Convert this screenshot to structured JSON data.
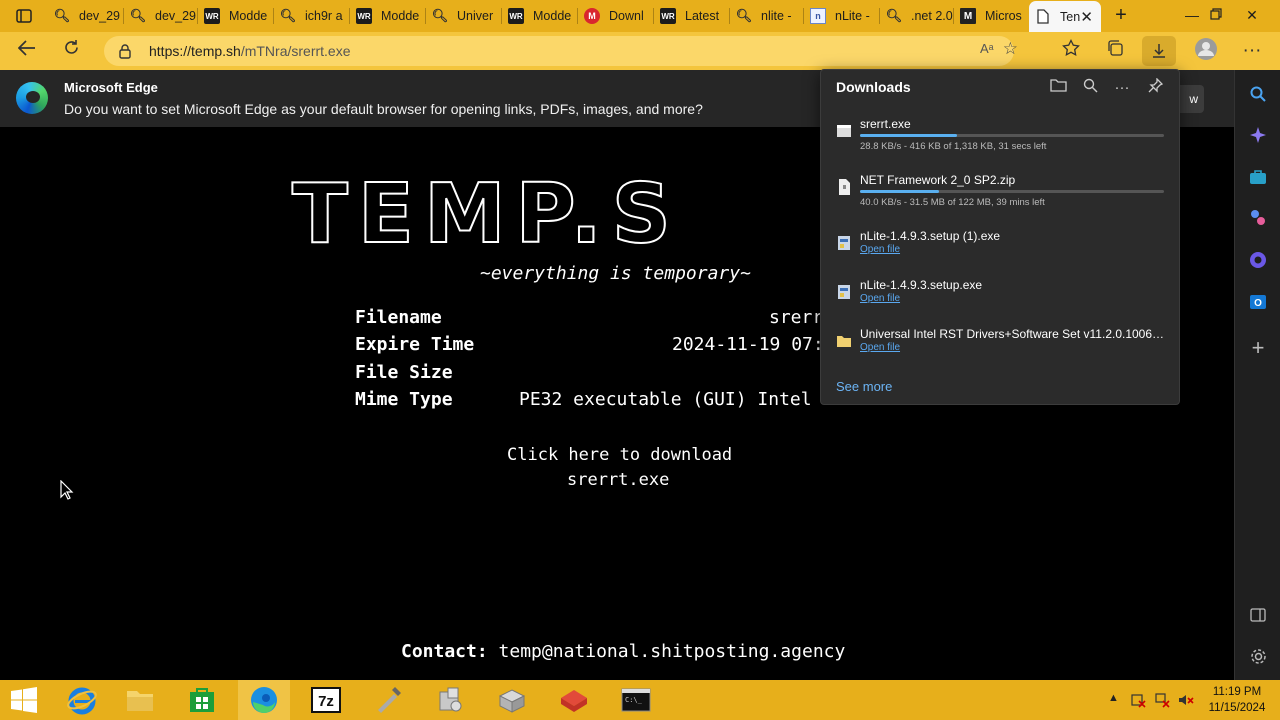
{
  "tabs": [
    {
      "label": "dev_29",
      "icon": "search-icon"
    },
    {
      "label": "dev_29",
      "icon": "search-icon"
    },
    {
      "label": "Modde",
      "icon": "wr-icon"
    },
    {
      "label": "ich9r a",
      "icon": "search-icon"
    },
    {
      "label": "Modde",
      "icon": "wr-icon"
    },
    {
      "label": "Univer",
      "icon": "search-icon"
    },
    {
      "label": "Modde",
      "icon": "wr-icon"
    },
    {
      "label": "Downl",
      "icon": "mega-icon"
    },
    {
      "label": "Latest",
      "icon": "wr-icon"
    },
    {
      "label": "nlite -",
      "icon": "search-icon"
    },
    {
      "label": "nLite -",
      "icon": "page-icon"
    },
    {
      "label": ".net 2.0",
      "icon": "search-icon"
    },
    {
      "label": "Micros",
      "icon": "ms-icon"
    },
    {
      "label": "Ten",
      "icon": "document-icon",
      "active": true
    }
  ],
  "address_bar": {
    "url_host": "https://temp.sh",
    "url_path": "/mTNra/srerrt.exe"
  },
  "banner": {
    "title": "Microsoft Edge",
    "text": "Do you want to set Microsoft Edge as your default browser for opening links, PDFs, images, and more?",
    "button": "w"
  },
  "page": {
    "logo": "TEMP.S",
    "tagline": "~everything is temporary~",
    "info": [
      {
        "label": "Filename",
        "value": "srerr"
      },
      {
        "label": "Expire Time",
        "value": "2024-11-19 07:"
      },
      {
        "label": "File Size",
        "value": ""
      },
      {
        "label": "Mime Type",
        "value": "PE32 executable (GUI) Intel"
      }
    ],
    "download_link": "Click here to download",
    "download_name": "srerrt.exe",
    "contact_label": "Contact:",
    "contact_email": "temp@national.shitposting.agency"
  },
  "downloads": {
    "title": "Downloads",
    "items": [
      {
        "name": "srerrt.exe",
        "status": "28.8 KB/s - 416 KB of 1,318 KB, 31 secs left",
        "progress": 0.32
      },
      {
        "name": "NET Framework 2_0 SP2.zip",
        "status": "40.0 KB/s - 31.5 MB of 122 MB, 39 mins left",
        "progress": 0.26
      },
      {
        "name": "nLite-1.4.9.3.setup (1).exe",
        "action": "Open file"
      },
      {
        "name": "nLite-1.4.9.3.setup.exe",
        "action": "Open file"
      },
      {
        "name": "Universal Intel RST Drivers+Software Set v11.2.0.1006 m...",
        "action": "Open file"
      }
    ],
    "see_more": "See more"
  },
  "clock": {
    "time": "11:19 PM",
    "date": "11/15/2024"
  },
  "colors": {
    "titlebar": "#e7af1b",
    "toolbar": "#f4c53c",
    "banner": "#262626",
    "page_bg": "#000000",
    "flyout_bg": "#2b2b2b",
    "accent_link": "#6cb4f5"
  }
}
